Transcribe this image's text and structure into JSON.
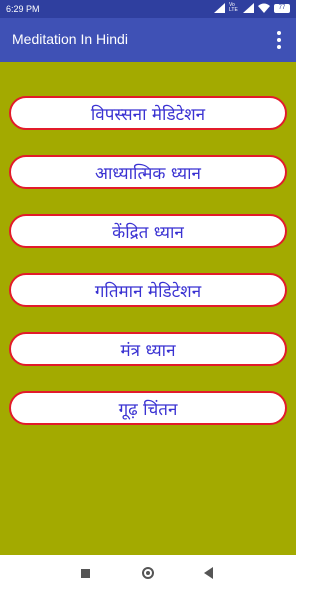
{
  "status_bar": {
    "time": "6:29 PM",
    "network_label": "Vo LTE",
    "battery": "77"
  },
  "app_bar": {
    "title": "Meditation In Hindi"
  },
  "menu": {
    "items": [
      {
        "label": "विपस्सना मेडिटेशन"
      },
      {
        "label": "आध्यात्मिक ध्यान"
      },
      {
        "label": "केंद्रित ध्यान"
      },
      {
        "label": "गतिमान मेडिटेशन"
      },
      {
        "label": "मंत्र ध्यान"
      },
      {
        "label": "गूढ़ चिंतन"
      }
    ]
  },
  "colors": {
    "app_bar": "#3f51b5",
    "status_bar": "#2f3f9f",
    "background": "#a3aa00",
    "button_border": "#e21b2a",
    "button_text": "#3a32d2"
  }
}
